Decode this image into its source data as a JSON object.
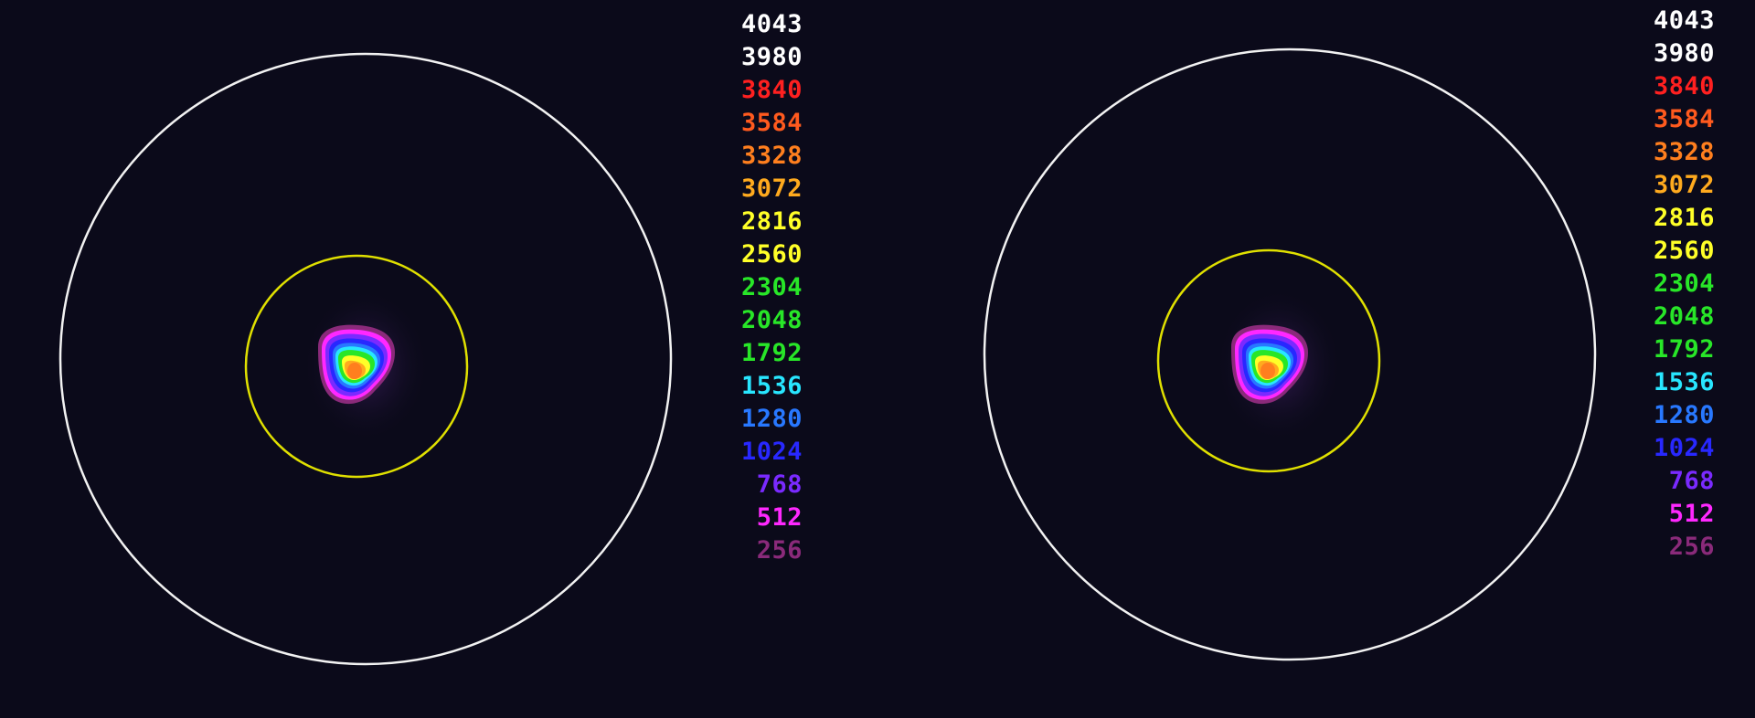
{
  "colors": {
    "background": "#0b0a1a",
    "outer_ring": "#f2f2f2",
    "inner_ring": "#e0e000"
  },
  "legend_levels": [
    {
      "label": "4043",
      "color": "#ffffff"
    },
    {
      "label": "3980",
      "color": "#ffffff"
    },
    {
      "label": "3840",
      "color": "#ff2020"
    },
    {
      "label": "3584",
      "color": "#ff5a1e"
    },
    {
      "label": "3328",
      "color": "#ff7f1e"
    },
    {
      "label": "3072",
      "color": "#ffaa1e"
    },
    {
      "label": "2816",
      "color": "#ffff28"
    },
    {
      "label": "2560",
      "color": "#ffff28"
    },
    {
      "label": "2304",
      "color": "#28e628"
    },
    {
      "label": "2048",
      "color": "#28e628"
    },
    {
      "label": "1792",
      "color": "#28e628"
    },
    {
      "label": "1536",
      "color": "#28e6ff"
    },
    {
      "label": "1280",
      "color": "#2878ff"
    },
    {
      "label": "1024",
      "color": "#2828ff"
    },
    {
      "label": "768",
      "color": "#7a2aff"
    },
    {
      "label": "512",
      "color": "#ff28ff"
    },
    {
      "label": "256",
      "color": "#8a2a7a"
    }
  ],
  "panels": [
    {
      "name": "left"
    },
    {
      "name": "right"
    }
  ]
}
